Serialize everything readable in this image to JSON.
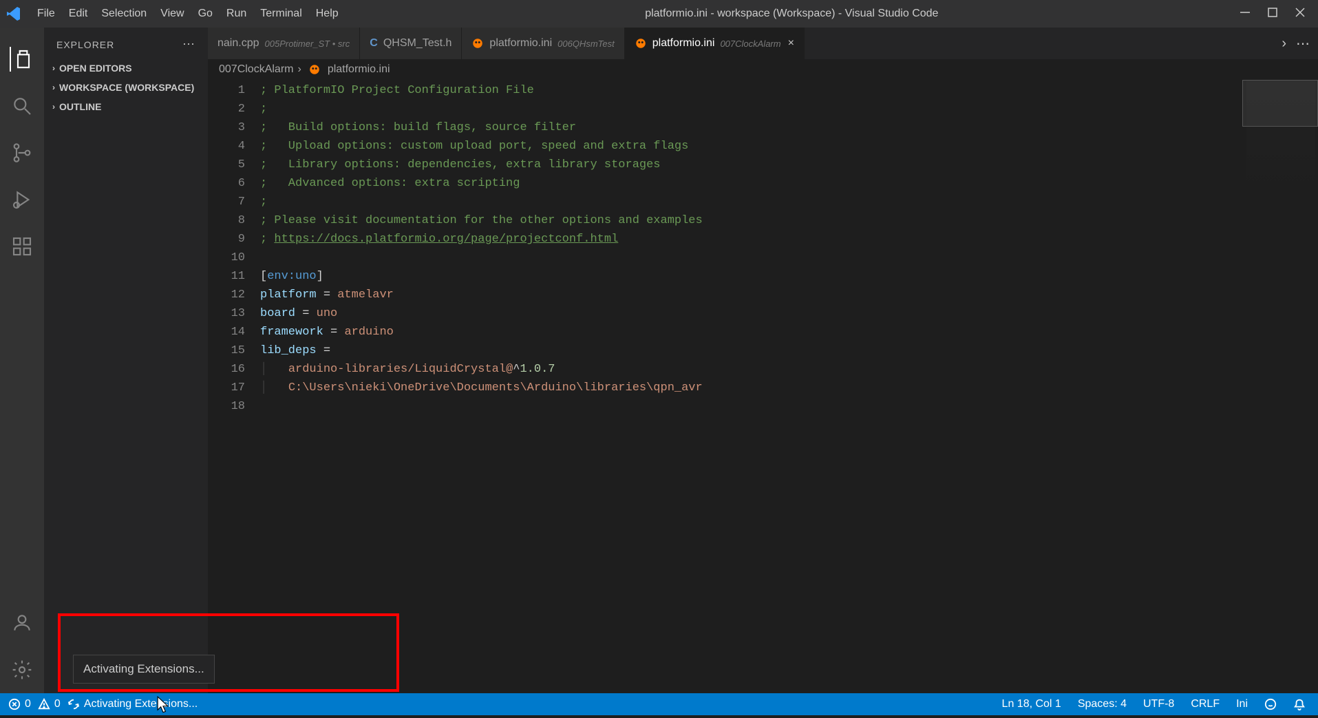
{
  "window": {
    "title": "platformio.ini - workspace (Workspace) - Visual Studio Code"
  },
  "menu": {
    "file": "File",
    "edit": "Edit",
    "selection": "Selection",
    "view": "View",
    "go": "Go",
    "run": "Run",
    "terminal": "Terminal",
    "help": "Help"
  },
  "sidebar": {
    "title": "EXPLORER",
    "sections": {
      "open_editors": "OPEN EDITORS",
      "workspace": "WORKSPACE (WORKSPACE)",
      "outline": "OUTLINE"
    }
  },
  "tabs": [
    {
      "label": "nain.cpp",
      "sub": "005Protimer_ST • src",
      "icon": "text",
      "dirty": false,
      "active": false
    },
    {
      "label": "QHSM_Test.h",
      "sub": "",
      "icon": "C",
      "dirty": false,
      "active": false
    },
    {
      "label": "platformio.ini",
      "sub": "006QHsmTest",
      "icon": "pio",
      "dirty": false,
      "active": false
    },
    {
      "label": "platformio.ini",
      "sub": "007ClockAlarm",
      "icon": "pio",
      "dirty": false,
      "active": true,
      "closable": true
    }
  ],
  "breadcrumbs": {
    "folder": "007ClockAlarm",
    "file": "platformio.ini"
  },
  "editor": {
    "lines": [
      {
        "n": 1,
        "seg": [
          {
            "c": "tk-comment",
            "t": "; PlatformIO Project Configuration File"
          }
        ]
      },
      {
        "n": 2,
        "seg": [
          {
            "c": "tk-comment",
            "t": ";"
          }
        ]
      },
      {
        "n": 3,
        "seg": [
          {
            "c": "tk-comment",
            "t": ";   Build options: build flags, source filter"
          }
        ]
      },
      {
        "n": 4,
        "seg": [
          {
            "c": "tk-comment",
            "t": ";   Upload options: custom upload port, speed and extra flags"
          }
        ]
      },
      {
        "n": 5,
        "seg": [
          {
            "c": "tk-comment",
            "t": ";   Library options: dependencies, extra library storages"
          }
        ]
      },
      {
        "n": 6,
        "seg": [
          {
            "c": "tk-comment",
            "t": ";   Advanced options: extra scripting"
          }
        ]
      },
      {
        "n": 7,
        "seg": [
          {
            "c": "tk-comment",
            "t": ";"
          }
        ]
      },
      {
        "n": 8,
        "seg": [
          {
            "c": "tk-comment",
            "t": "; Please visit documentation for the other options and examples"
          }
        ]
      },
      {
        "n": 9,
        "seg": [
          {
            "c": "tk-comment",
            "t": "; "
          },
          {
            "c": "tk-link",
            "t": "https://docs.platformio.org/page/projectconf.html"
          }
        ]
      },
      {
        "n": 10,
        "seg": [
          {
            "c": "",
            "t": ""
          }
        ]
      },
      {
        "n": 11,
        "seg": [
          {
            "c": "tk-op",
            "t": "["
          },
          {
            "c": "tk-section",
            "t": "env:uno"
          },
          {
            "c": "tk-op",
            "t": "]"
          }
        ]
      },
      {
        "n": 12,
        "seg": [
          {
            "c": "tk-key",
            "t": "platform"
          },
          {
            "c": "tk-op",
            "t": " = "
          },
          {
            "c": "tk-val",
            "t": "atmelavr"
          }
        ]
      },
      {
        "n": 13,
        "seg": [
          {
            "c": "tk-key",
            "t": "board"
          },
          {
            "c": "tk-op",
            "t": " = "
          },
          {
            "c": "tk-val",
            "t": "uno"
          }
        ]
      },
      {
        "n": 14,
        "seg": [
          {
            "c": "tk-key",
            "t": "framework"
          },
          {
            "c": "tk-op",
            "t": " = "
          },
          {
            "c": "tk-val",
            "t": "arduino"
          }
        ]
      },
      {
        "n": 15,
        "seg": [
          {
            "c": "tk-key",
            "t": "lib_deps"
          },
          {
            "c": "tk-op",
            "t": " ="
          }
        ]
      },
      {
        "n": 16,
        "seg": [
          {
            "c": "indent-guide",
            "t": "│   "
          },
          {
            "c": "tk-val",
            "t": "arduino-libraries/LiquidCrystal@"
          },
          {
            "c": "tk-op",
            "t": "^"
          },
          {
            "c": "tk-num",
            "t": "1.0.7"
          }
        ]
      },
      {
        "n": 17,
        "seg": [
          {
            "c": "indent-guide",
            "t": "│   "
          },
          {
            "c": "tk-val",
            "t": "C:\\Users\\nieki\\OneDrive\\Documents\\Arduino\\libraries\\qpn_avr"
          }
        ]
      },
      {
        "n": 18,
        "seg": [
          {
            "c": "",
            "t": ""
          }
        ]
      }
    ]
  },
  "tooltip": {
    "text": "Activating Extensions..."
  },
  "status": {
    "errors": "0",
    "warnings": "0",
    "activating": "Activating Extensions...",
    "cursor": "Ln 18, Col 1",
    "spaces": "Spaces: 4",
    "encoding": "UTF-8",
    "eol": "CRLF",
    "lang": "Ini"
  }
}
